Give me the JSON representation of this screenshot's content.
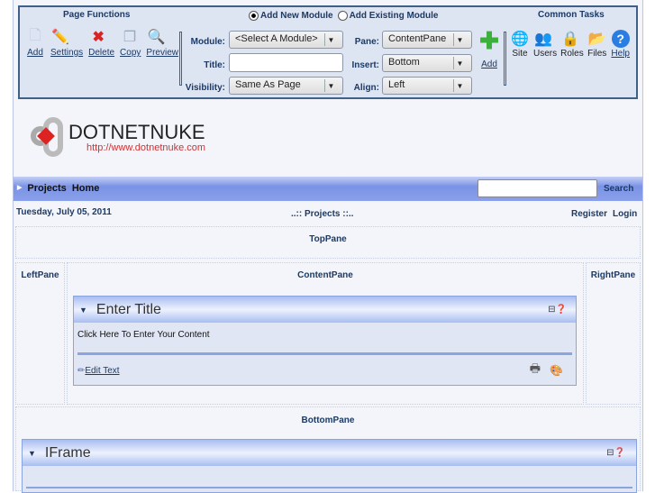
{
  "control_panel": {
    "page_functions_title": "Page Functions",
    "page_functions": [
      {
        "label": "Add",
        "icon": "page-add-icon"
      },
      {
        "label": "Settings",
        "icon": "page-settings-icon"
      },
      {
        "label": "Delete",
        "icon": "page-delete-icon"
      },
      {
        "label": "Copy",
        "icon": "page-copy-icon"
      },
      {
        "label": "Preview",
        "icon": "page-preview-icon"
      }
    ],
    "radio_new": "Add New Module",
    "radio_existing": "Add Existing Module",
    "radio_selected": "new",
    "module_label": "Module:",
    "module_value": "<Select A Module>",
    "title_label": "Title:",
    "title_value": "",
    "visibility_label": "Visibility:",
    "visibility_value": "Same As Page",
    "pane_label": "Pane:",
    "pane_value": "ContentPane",
    "insert_label": "Insert:",
    "insert_value": "Bottom",
    "align_label": "Align:",
    "align_value": "Left",
    "add_label": "Add",
    "common_tasks_title": "Common Tasks",
    "common_tasks": [
      {
        "label": "Site",
        "icon": "site-icon"
      },
      {
        "label": "Users",
        "icon": "users-icon"
      },
      {
        "label": "Roles",
        "icon": "roles-icon"
      },
      {
        "label": "Files",
        "icon": "files-icon"
      },
      {
        "label": "Help",
        "icon": "help-icon"
      }
    ]
  },
  "logo": {
    "text": "DOTNETNUKE",
    "url": "http://www.dotnetnuke.com"
  },
  "nav": {
    "items": [
      "Projects",
      "Home"
    ],
    "search_value": "",
    "search_label": "Search"
  },
  "info": {
    "date": "Tuesday, July 05, 2011",
    "breadcrumb": "..:: Projects ::..",
    "register": "Register",
    "login": "Login"
  },
  "panes": {
    "top": "TopPane",
    "left": "LeftPane",
    "content": "ContentPane",
    "right": "RightPane",
    "bottom": "BottomPane"
  },
  "modules": [
    {
      "title": "Enter Title",
      "content": "Click Here To Enter Your Content",
      "edit_label": "Edit Text"
    },
    {
      "title": "IFrame"
    }
  ]
}
